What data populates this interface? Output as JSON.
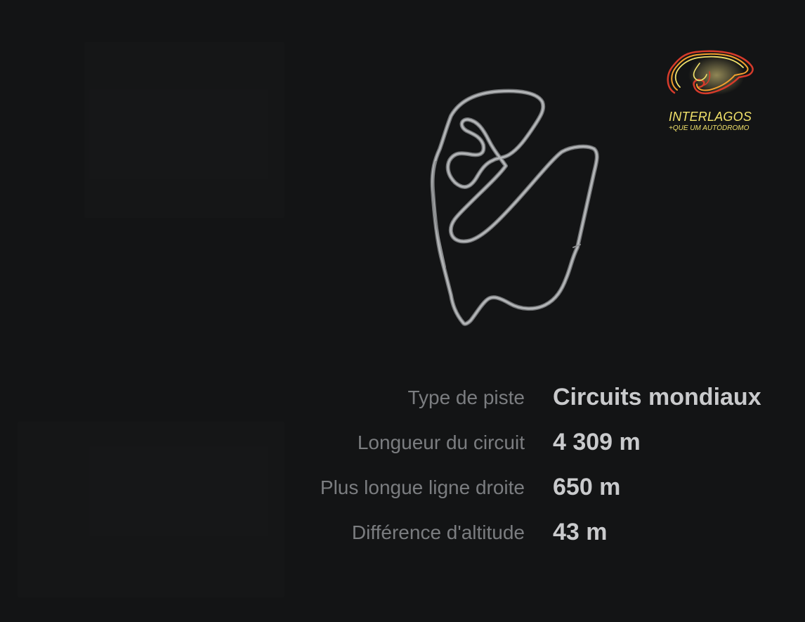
{
  "logo": {
    "title": "INTERLAGOS",
    "subtitle": "+QUE UM AUTÓDROMO"
  },
  "track": {
    "map_icon": "interlagos-track-outline"
  },
  "info": {
    "rows": [
      {
        "label": "Type de piste",
        "value": "Circuits mondiaux"
      },
      {
        "label": "Longueur du circuit",
        "value": "4 309 m"
      },
      {
        "label": "Plus longue ligne droite",
        "value": "650 m"
      },
      {
        "label": "Différence d'altitude",
        "value": "43 m"
      }
    ]
  },
  "colors": {
    "background": "#131415",
    "label": "#7b7d80",
    "value": "#c9cacc",
    "track": "#a7a9ab",
    "logo_yellow": "#f2e26b",
    "logo_red": "#d63b2b"
  }
}
